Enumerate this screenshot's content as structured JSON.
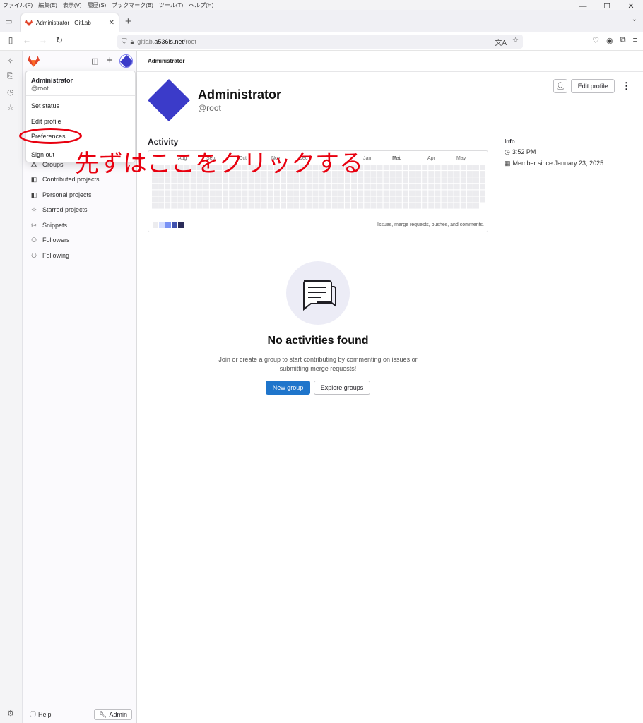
{
  "browser": {
    "menu": [
      "ファイル(F)",
      "編集(E)",
      "表示(V)",
      "履歴(S)",
      "ブックマーク(B)",
      "ツール(T)",
      "ヘルプ(H)"
    ],
    "tab_title": "Administrator · GitLab",
    "url_prefix": "gitlab.",
    "url_host": "a536is.net",
    "url_path": "/root"
  },
  "sidebar": {
    "items": [
      {
        "label": "Groups",
        "icon": "groups-icon"
      },
      {
        "label": "Contributed projects",
        "icon": "project-icon"
      },
      {
        "label": "Personal projects",
        "icon": "project-icon"
      },
      {
        "label": "Starred projects",
        "icon": "star-icon"
      },
      {
        "label": "Snippets",
        "icon": "snippet-icon"
      },
      {
        "label": "Followers",
        "icon": "users-icon"
      },
      {
        "label": "Following",
        "icon": "users-icon"
      }
    ],
    "help_label": "Help",
    "admin_label": "Admin"
  },
  "user_dropdown": {
    "name": "Administrator",
    "handle": "@root",
    "set_status": "Set status",
    "edit_profile": "Edit profile",
    "preferences": "Preferences",
    "sign_out": "Sign out"
  },
  "main": {
    "breadcrumb": "Administrator",
    "profile_name": "Administrator",
    "profile_handle": "@root",
    "edit_profile_label": "Edit profile",
    "activity_title": "Activity",
    "calendar_months": [
      "Aug",
      "Sep",
      "Oct",
      "Nov",
      "Dec",
      "Jan",
      "Feb",
      "Mar",
      "Apr",
      "May"
    ],
    "calendar_note": "Issues, merge requests, pushes, and comments.",
    "info_title": "Info",
    "info_time": "3:52 PM",
    "info_since": "Member since January 23, 2025",
    "empty_title": "No activities found",
    "empty_desc_1": "Join or create a group to start contributing by commenting on issues or",
    "empty_desc_2": "submitting merge requests!",
    "new_group_label": "New group",
    "explore_groups_label": "Explore groups"
  },
  "annotation": {
    "text": "先ずはここをクリックする",
    "color": "#e8000f"
  },
  "colors": {
    "accent": "#1f75cb",
    "avatar": "#3b3bc9",
    "legend": [
      "#ececef",
      "#d2dcff",
      "#7992f5",
      "#3f51ae",
      "#2a2b59"
    ]
  }
}
